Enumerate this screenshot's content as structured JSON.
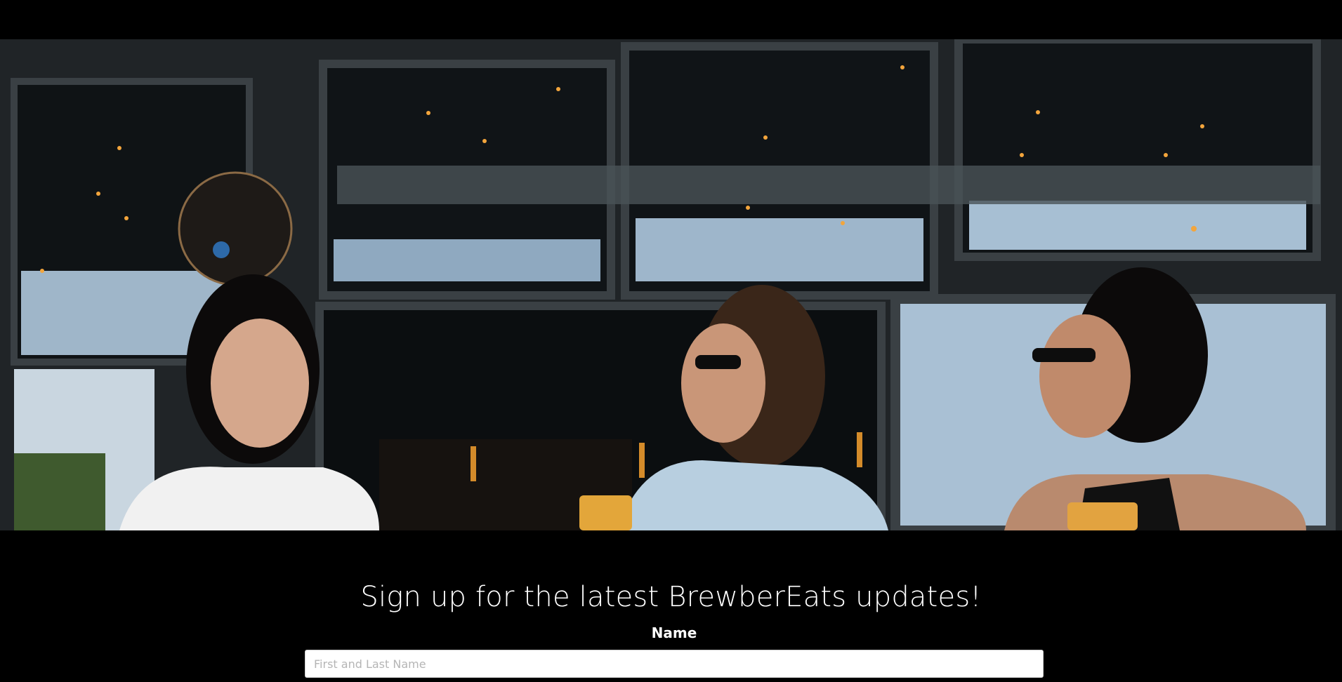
{
  "hero": {
    "image_description_icon": "photo-icon",
    "alt": ""
  },
  "signup": {
    "title": "Sign up for the latest BrewberEats updates!",
    "name_label": "Name",
    "name_placeholder": "First and Last Name",
    "name_value": ""
  },
  "colors": {
    "background": "#000000",
    "text": "#ffffff",
    "input_bg": "#ffffff",
    "placeholder": "#b5b5b5"
  }
}
